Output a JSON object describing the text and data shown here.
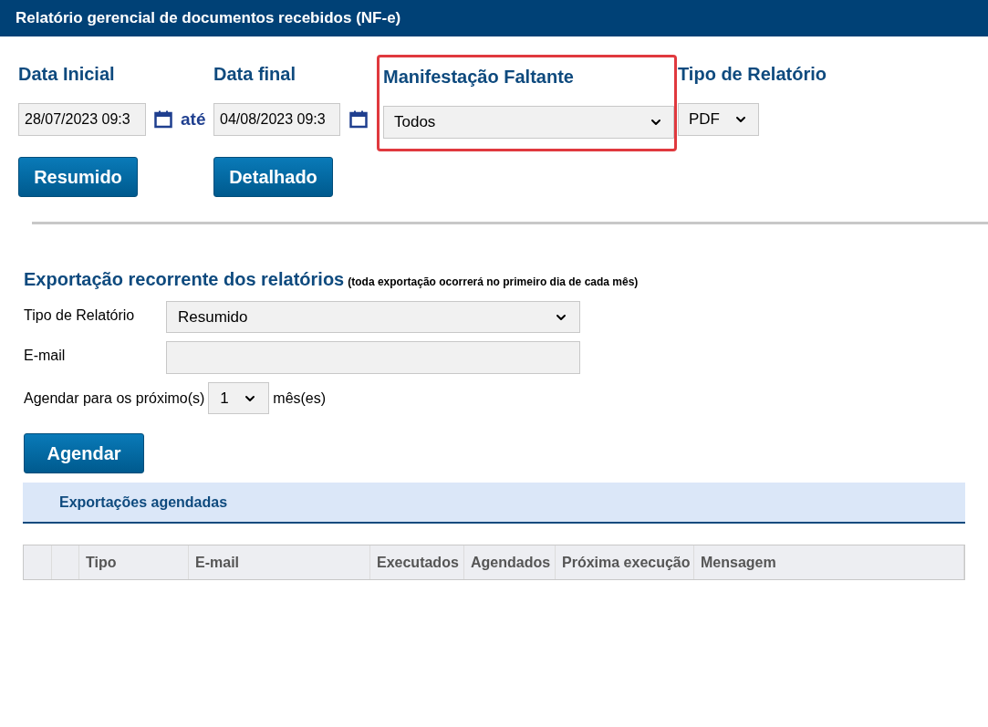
{
  "header": {
    "title": "Relatório gerencial de documentos recebidos (NF-e)"
  },
  "filters": {
    "date_start": {
      "label": "Data Inicial",
      "value": "28/07/2023 09:3"
    },
    "separator": "até",
    "date_end": {
      "label": "Data final",
      "value": "04/08/2023 09:3"
    },
    "missing_manifestation": {
      "label": "Manifestação Faltante",
      "value": "Todos",
      "highlighted": true
    },
    "report_type": {
      "label": "Tipo de Relatório",
      "value": "PDF"
    }
  },
  "buttons": [
    "Resumido",
    "Detalhado"
  ],
  "recurring_export": {
    "title": "Exportação recorrente dos relatórios",
    "note": "(toda exportação ocorrerá no primeiro dia de cada mês)",
    "report_type": {
      "label": "Tipo de Relatório",
      "value": "Resumido"
    },
    "email": {
      "label": "E-mail"
    },
    "schedule": {
      "label": "Agendar para os próximo(s)",
      "value": "1",
      "suffix": "mês(es)"
    },
    "button": "Agendar"
  },
  "scheduled_exports": {
    "title": "Exportações agendadas",
    "columns": [
      "Tipo",
      "E-mail",
      "Executados",
      "Agendados",
      "Próxima execução",
      "Mensagem"
    ]
  }
}
